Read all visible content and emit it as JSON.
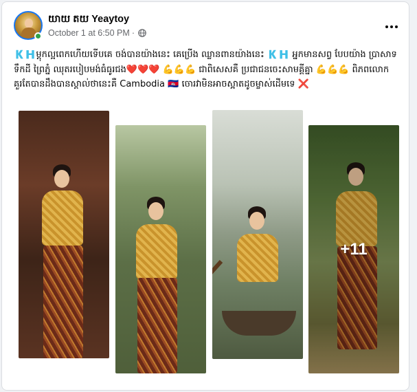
{
  "post": {
    "author_name": "យាយ តយ Yeaytoy",
    "timestamp": "October 1 at 6:50 PM",
    "separator": "·",
    "audience_icon": "globe-icon",
    "more_options_icon": "more-horizontal-icon",
    "text": "🇰🇭ម្ដុកល្អពេកហើយទើបគេ ចង់បានយ៉ាងនេះ គេប្រើង ឈ្លានពានយ៉ាងនេះ 🇰🇭 អ្នកមានសព្វ បែបយ៉ាង ប្រាសាទ ទឹកដី ព្រៃភ្នំ ឈុតរបៀបមង់ធំធូរជង❤️❤️❤️ 💪💪💪 ជាពិសេសគឺ ប្រជាជនចេះសាមគ្គីគ្នា 💪💪💪 ពិភពលោកគួរតែបានដឹងបានស្គាល់ថានេះគឺ Cambodia 🇰🇭 ចោរវាមិនអាចស្អាតដូចម្ចាស់ដើមទេ ❌",
    "photos": [
      {
        "label": "photo-1"
      },
      {
        "label": "photo-2"
      },
      {
        "label": "photo-3"
      },
      {
        "label": "photo-4"
      }
    ],
    "more_photos_label": "+11"
  },
  "colors": {
    "accent": "#1877f2",
    "online": "#31a24c",
    "meta_text": "#65676b",
    "heart": "#e41e3f",
    "cross": "#e41e3f"
  }
}
